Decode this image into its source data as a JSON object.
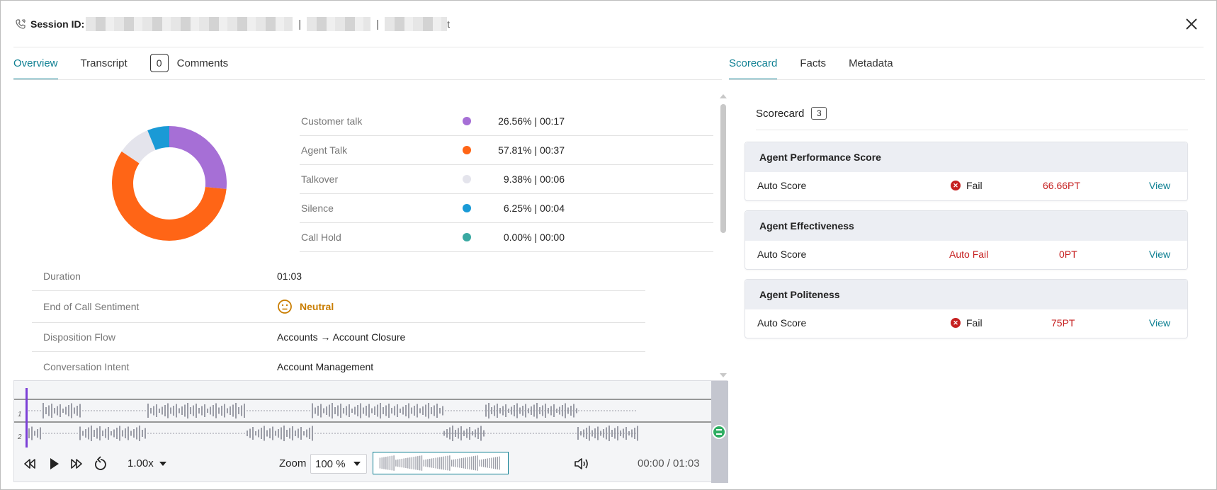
{
  "header": {
    "session_label": "Session ID:",
    "masked_suffix": "t",
    "separator": "|"
  },
  "left_tabs": [
    {
      "label": "Overview",
      "active": true
    },
    {
      "label": "Transcript",
      "active": false
    },
    {
      "label": "Comments",
      "count": "0",
      "active": false
    }
  ],
  "right_tabs": [
    {
      "label": "Scorecard",
      "active": true
    },
    {
      "label": "Facts",
      "active": false
    },
    {
      "label": "Metadata",
      "active": false
    }
  ],
  "talk_breakdown": [
    {
      "label": "Customer talk",
      "value": "26.56% | 00:17",
      "color": "#a66fd6",
      "percent": 26.56
    },
    {
      "label": "Agent Talk",
      "value": "57.81% | 00:37",
      "color": "#ff6516",
      "percent": 57.81
    },
    {
      "label": "Talkover",
      "value": "9.38% | 00:06",
      "color": "#e4e4ec",
      "percent": 9.38
    },
    {
      "label": "Silence",
      "value": "6.25% | 00:04",
      "color": "#1a9ad6",
      "percent": 6.25
    },
    {
      "label": "Call Hold",
      "value": "0.00% | 00:00",
      "color": "#3aa9a2",
      "percent": 0.0
    }
  ],
  "call_info": [
    {
      "label": "Duration",
      "value": "01:03"
    },
    {
      "label": "End of Call Sentiment",
      "value": "Neutral",
      "icon": "neutral-face-icon"
    },
    {
      "label": "Disposition Flow",
      "value": "Accounts → Account Closure"
    },
    {
      "label": "Conversation Intent",
      "value": "Account Management"
    }
  ],
  "player": {
    "channels": [
      "1",
      "2"
    ],
    "speed": "1.00x",
    "zoom_label": "Zoom",
    "zoom_value": "100 %",
    "time": "00:00 / 01:03",
    "accent": "#7b3fd6"
  },
  "scorecard": {
    "title": "Scorecard",
    "count": "3",
    "cards": [
      {
        "name": "Agent Performance Score",
        "row_label": "Auto Score",
        "status": "Fail",
        "status_type": "fail",
        "score": "66.66PT",
        "view": "View"
      },
      {
        "name": "Agent Effectiveness",
        "row_label": "Auto Score",
        "status": "Auto Fail",
        "status_type": "autofail",
        "score": "0PT",
        "view": "View"
      },
      {
        "name": "Agent Politeness",
        "row_label": "Auto Score",
        "status": "Fail",
        "status_type": "fail",
        "score": "75PT",
        "view": "View"
      }
    ]
  },
  "colors": {
    "accent": "#0d7f92",
    "fail": "#c62020",
    "neutral": "#c97d00"
  }
}
